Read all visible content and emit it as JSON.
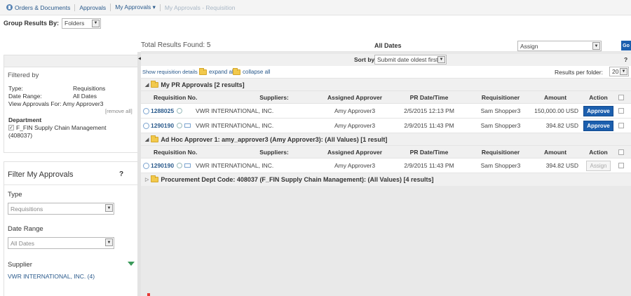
{
  "breadcrumb": {
    "items": [
      "Orders & Documents",
      "Approvals",
      "My Approvals ▾",
      "My Approvals - Requisition"
    ]
  },
  "group_by": {
    "label": "Group Results By:",
    "value": "Folders"
  },
  "summary": {
    "total": "Total Results Found: 5",
    "dates": "All Dates",
    "assign_value": "Assign",
    "go_label": "Go",
    "sort_label": "Sort by:",
    "sort_value": "Submit date oldest first",
    "help": "?",
    "show_details": "Show requisition details",
    "expand_all": "expand all",
    "collapse_all": "collapse all",
    "per_folder_label": "Results per folder:",
    "per_folder_value": "20"
  },
  "filtered_by": {
    "title": "Filtered by",
    "rows": [
      {
        "label": "Type:",
        "value": "Requisitions"
      },
      {
        "label": "Date Range:",
        "value": "All Dates"
      }
    ],
    "view_for": "View Approvals For: Amy Approver3",
    "remove_all": "[remove all]",
    "department_title": "Department",
    "department_value": "F_FIN Supply Chain Management",
    "department_code": "(408037)"
  },
  "filter_panel": {
    "title": "Filter My Approvals",
    "help": "?",
    "type_label": "Type",
    "type_value": "Requisitions",
    "date_label": "Date Range",
    "date_value": "All Dates",
    "supplier_label": "Supplier",
    "supplier_value": "VWR INTERNATIONAL, INC. (4)"
  },
  "columns": [
    "Requisition No.",
    "Suppliers:",
    "Assigned Approver",
    "PR Date/Time",
    "Requisitioner",
    "Amount",
    "Action"
  ],
  "folders": [
    {
      "title": "My PR Approvals [2 results]",
      "rows": [
        {
          "req": "1288025",
          "supplier": "VWR INTERNATIONAL, INC.",
          "approver": "Amy Approver3",
          "date": "2/5/2015 12:13 PM",
          "requisitioner": "Sam Shopper3",
          "amount": "150,000.00 USD",
          "action": "Approve"
        },
        {
          "req": "1290190",
          "supplier": "VWR INTERNATIONAL, INC.",
          "approver": "Amy Approver3",
          "date": "2/9/2015 11:43 PM",
          "requisitioner": "Sam Shopper3",
          "amount": "394.82 USD",
          "action": "Approve"
        }
      ]
    },
    {
      "title": "Ad Hoc Approver 1: amy_approver3 (Amy Approver3): (All Values) [1 result]",
      "rows": [
        {
          "req": "1290190",
          "supplier": "VWR INTERNATIONAL, INC.",
          "approver": "Amy Approver3",
          "date": "2/9/2015 11:43 PM",
          "requisitioner": "Sam Shopper3",
          "amount": "394.82 USD",
          "action": "Assign"
        }
      ]
    },
    {
      "title": "Procurement Dept Code: 408037 (F_FIN Supply Chain Management): (All Values) [4 results]",
      "rows": []
    }
  ]
}
